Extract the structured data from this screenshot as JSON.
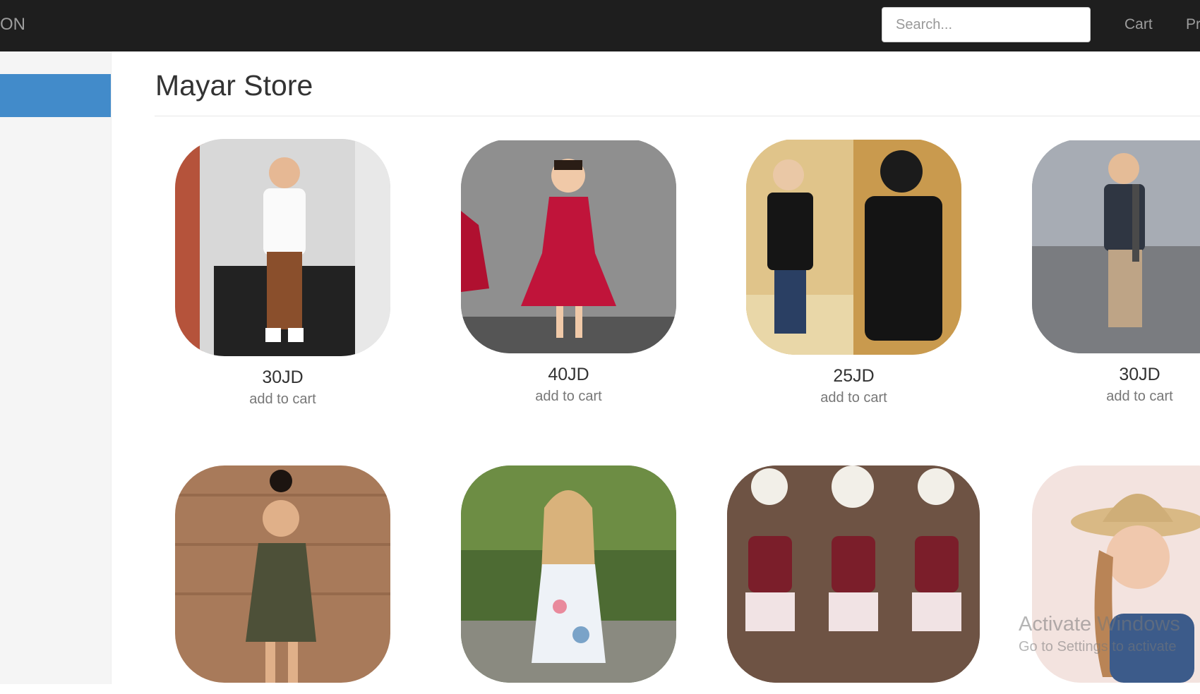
{
  "navbar": {
    "brand": "ON",
    "search_placeholder": "Search...",
    "links": [
      "Cart",
      "Pr"
    ]
  },
  "page": {
    "title": "Mayar Store"
  },
  "products": [
    {
      "price": "30JD",
      "action": "add to cart"
    },
    {
      "price": "40JD",
      "action": "add to cart"
    },
    {
      "price": "25JD",
      "action": "add to cart"
    },
    {
      "price": "30JD",
      "action": "add to cart"
    },
    {
      "price": "",
      "action": ""
    },
    {
      "price": "",
      "action": ""
    },
    {
      "price": "",
      "action": ""
    },
    {
      "price": "",
      "action": ""
    }
  ],
  "watermark": {
    "title": "Activate Windows",
    "subtitle": "Go to Settings to activate"
  },
  "colors": {
    "navbar": "#1e1e1e",
    "sidebar_active": "#428bca",
    "sidebar": "#f5f5f5"
  }
}
